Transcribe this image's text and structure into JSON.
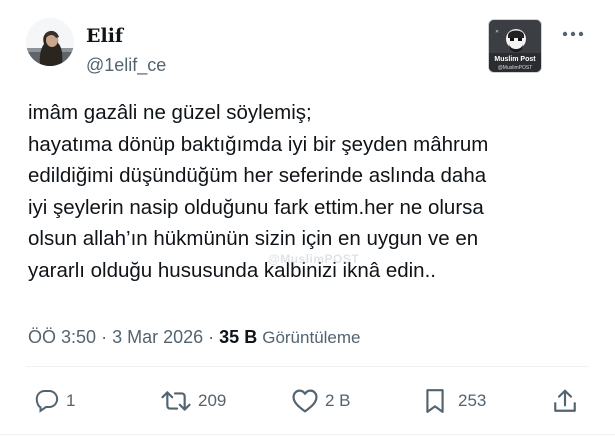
{
  "author": {
    "display_name": "Elif",
    "handle": "@1elif_ce"
  },
  "badge": {
    "name": "Muslim Post",
    "handle": "@MuslimPOST"
  },
  "watermark": "@MuslimPOST",
  "tweet": {
    "lines": [
      "imâm gazâli ne güzel söylemiş;",
      "hayatıma dönüp baktığımda iyi bir şeyden mâhrum",
      "edildiğimi düşündüğüm her seferinde aslında daha",
      "iyi şeylerin nasip olduğunu fark ettim.her ne olursa",
      "olsun allah’ın hükmünün sizin için en uygun ve en",
      "yararlı olduğu hususunda kalbinizi iknâ edin.."
    ]
  },
  "meta": {
    "time": "ÖÖ 3:50",
    "separator": "·",
    "date": "3 Mar 2026",
    "views_count": "35 B",
    "views_label": "Görüntüleme"
  },
  "actions": {
    "replies": "1",
    "reposts": "209",
    "likes": "2 B",
    "bookmarks": "253"
  },
  "colors": {
    "text_primary": "#0f1419",
    "text_secondary": "#536471",
    "divider": "#eff3f4",
    "background": "#ffffff"
  },
  "icons": [
    "more-icon",
    "reply-icon",
    "repost-icon",
    "like-icon",
    "bookmark-icon",
    "share-icon"
  ]
}
